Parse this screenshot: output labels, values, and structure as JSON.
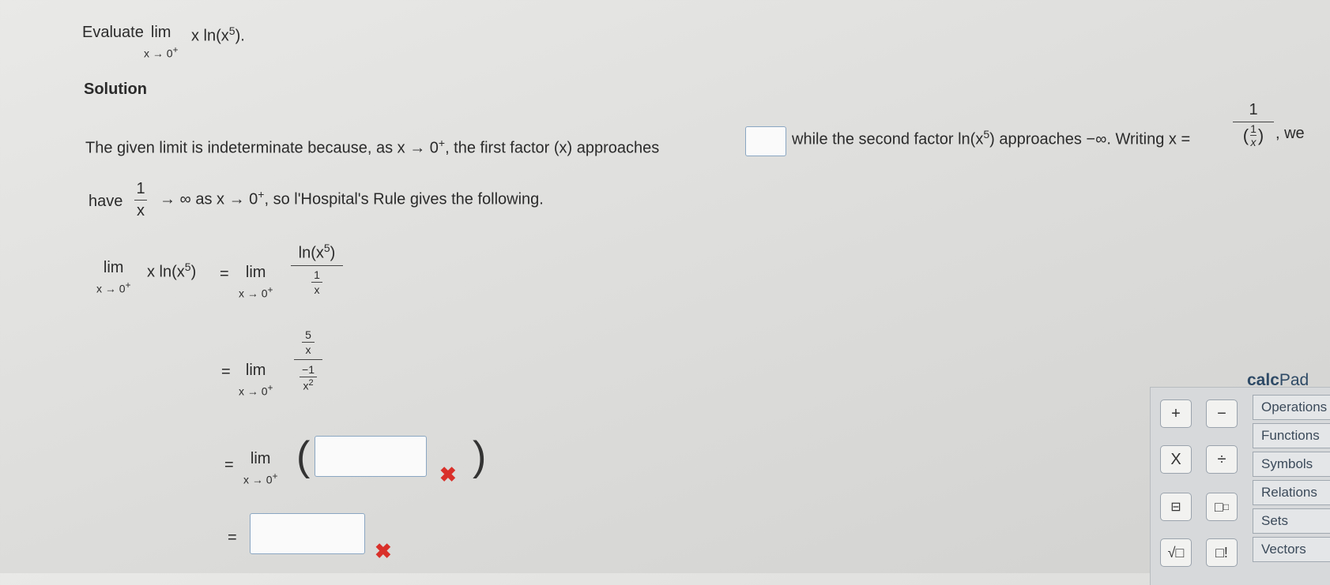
{
  "problem": {
    "evaluate": "Evaluate",
    "lim": "lim",
    "lim_sub": "x → 0",
    "lim_sup": "+",
    "expr_x": "x ln(x",
    "expr_exp": "5",
    "expr_tail": ")."
  },
  "solution": {
    "heading": "Solution",
    "line1_a": "The given limit is indeterminate because, as x  →  0",
    "line1_sup": "+",
    "line1_b": ", the first factor (x) approaches",
    "line1_c": "while the second factor ln(x",
    "line1_c_exp": "5",
    "line1_d": ") approaches −∞. Writing x =",
    "frac_num": "1",
    "inner_num": "1",
    "inner_den": "x",
    "line1_e": ", we",
    "line2_have": "have",
    "line2_num": "1",
    "line2_den": "x",
    "line2_b": "→  ∞ as x  →  0",
    "line2_sup": "+",
    "line2_c": ", so l'Hospital's Rule gives the following."
  },
  "steps": {
    "lhs": "x ln(x",
    "lhs_exp": "5",
    "lhs_close": ")",
    "eq": "=",
    "s1_num": "ln(x",
    "s1_num_exp": "5",
    "s1_num_close": ")",
    "s1_den_num": "1",
    "s1_den_den": "x",
    "s2_num_num": "5",
    "s2_num_den": "x",
    "s2_den_num": "−1",
    "s2_den_den": "x",
    "s2_den_exp": "2",
    "paren_open": "(",
    "paren_close": ")",
    "x_mark": "✖"
  },
  "calcpad": {
    "title_a": "calc",
    "title_b": "Pad",
    "buttons": {
      "plus": "+",
      "minus": "−",
      "times": "X",
      "divide": "÷",
      "fraction": "⊟",
      "power": "□",
      "power_sup": "□",
      "sqrt": "√□",
      "factorial": "□!"
    },
    "tabs": [
      "Operations",
      "Functions",
      "Symbols",
      "Relations",
      "Sets",
      "Vectors"
    ]
  }
}
